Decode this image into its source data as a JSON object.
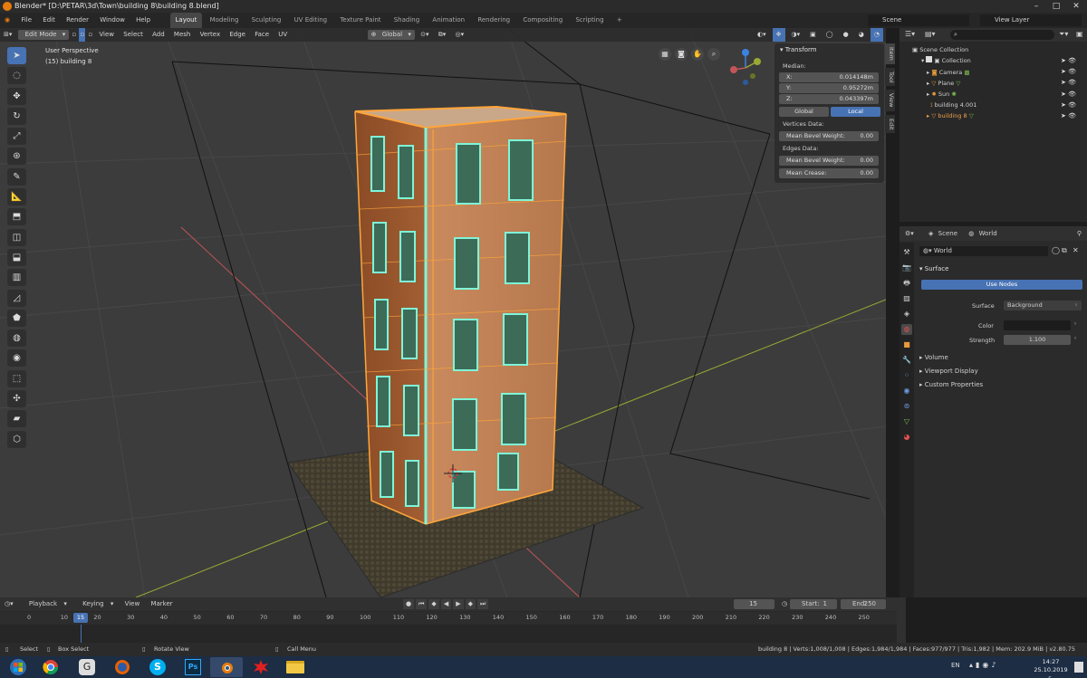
{
  "window": {
    "title": "Blender* [D:\\PETAR\\3d\\Town\\building 8\\building 8.blend]"
  },
  "menu": [
    "File",
    "Edit",
    "Render",
    "Window",
    "Help"
  ],
  "workspaces": [
    "Layout",
    "Modeling",
    "Sculpting",
    "UV Editing",
    "Texture Paint",
    "Shading",
    "Animation",
    "Rendering",
    "Compositing",
    "Scripting"
  ],
  "active_workspace": "Layout",
  "scene_selector": "Scene",
  "view_layer_selector": "View Layer",
  "viewport_header": {
    "mode": "Edit Mode",
    "menus": [
      "View",
      "Select",
      "Add",
      "Mesh",
      "Vertex",
      "Edge",
      "Face",
      "UV"
    ],
    "orientation": "Global"
  },
  "viewport_info": {
    "perspective": "User Perspective",
    "object": "(15) building 8"
  },
  "transform_panel": {
    "title": "Transform",
    "median_label": "Median:",
    "x_label": "X:",
    "x_value": "0.014148m",
    "y_label": "Y:",
    "y_value": "0.95272m",
    "z_label": "Z:",
    "z_value": "0.043397m",
    "global_label": "Global",
    "local_label": "Local",
    "vertices_data_label": "Vertices Data:",
    "vertex_bevel_label": "Mean Bevel Weight:",
    "vertex_bevel_value": "0.00",
    "edges_data_label": "Edges Data:",
    "edge_bevel_label": "Mean Bevel Weight:",
    "edge_bevel_value": "0.00",
    "crease_label": "Mean Crease:",
    "crease_value": "0.00"
  },
  "sidebar_tabs": [
    "Item",
    "Tool",
    "View",
    "Edit"
  ],
  "outliner": {
    "scene_collection": "Scene Collection",
    "items": [
      {
        "label": "Collection"
      },
      {
        "label": "Camera"
      },
      {
        "label": "Plane"
      },
      {
        "label": "Sun"
      },
      {
        "label": "building 4.001"
      },
      {
        "label": "building 8"
      }
    ]
  },
  "properties": {
    "breadcrumb_scene": "Scene",
    "breadcrumb_world": "World",
    "world_name": "World",
    "surface_panel": "Surface",
    "use_nodes_label": "Use Nodes",
    "surface_label": "Surface",
    "surface_value": "Background",
    "color_label": "Color",
    "strength_label": "Strength",
    "strength_value": "1.100",
    "volume_panel": "Volume",
    "viewport_display_panel": "Viewport Display",
    "custom_properties_panel": "Custom Properties"
  },
  "timeline": {
    "menus": [
      "Playback",
      "Keying",
      "View",
      "Marker"
    ],
    "current_frame": "15",
    "start_label": "Start:",
    "start_value": "1",
    "end_label": "End:",
    "end_value": "250",
    "ruler_ticks": [
      "0",
      "10",
      "20",
      "30",
      "40",
      "50",
      "60",
      "70",
      "80",
      "90",
      "100",
      "110",
      "120",
      "130",
      "140",
      "150",
      "160",
      "170",
      "180",
      "190",
      "200",
      "210",
      "220",
      "230",
      "240",
      "250"
    ],
    "playhead": "15"
  },
  "status_bar": {
    "select": "Select",
    "box_select": "Box Select",
    "rotate_view": "Rotate View",
    "call_menu": "Call Menu",
    "stats": "building 8 | Verts:1,008/1,008 | Edges:1,984/1,984 | Faces:977/977 | Tris:1,982 | Mem: 202.9 MiB | v2.80.75"
  },
  "taskbar": {
    "language": "EN",
    "time": "14:27",
    "date": "25.10.2019 г."
  },
  "colors": {
    "accent_blue": "#4772b3",
    "edit_select_orange": "#ffa53a",
    "face_teal": "#7ff5d8",
    "axis_red": "#c25559",
    "axis_yellow": "#9aa834"
  }
}
